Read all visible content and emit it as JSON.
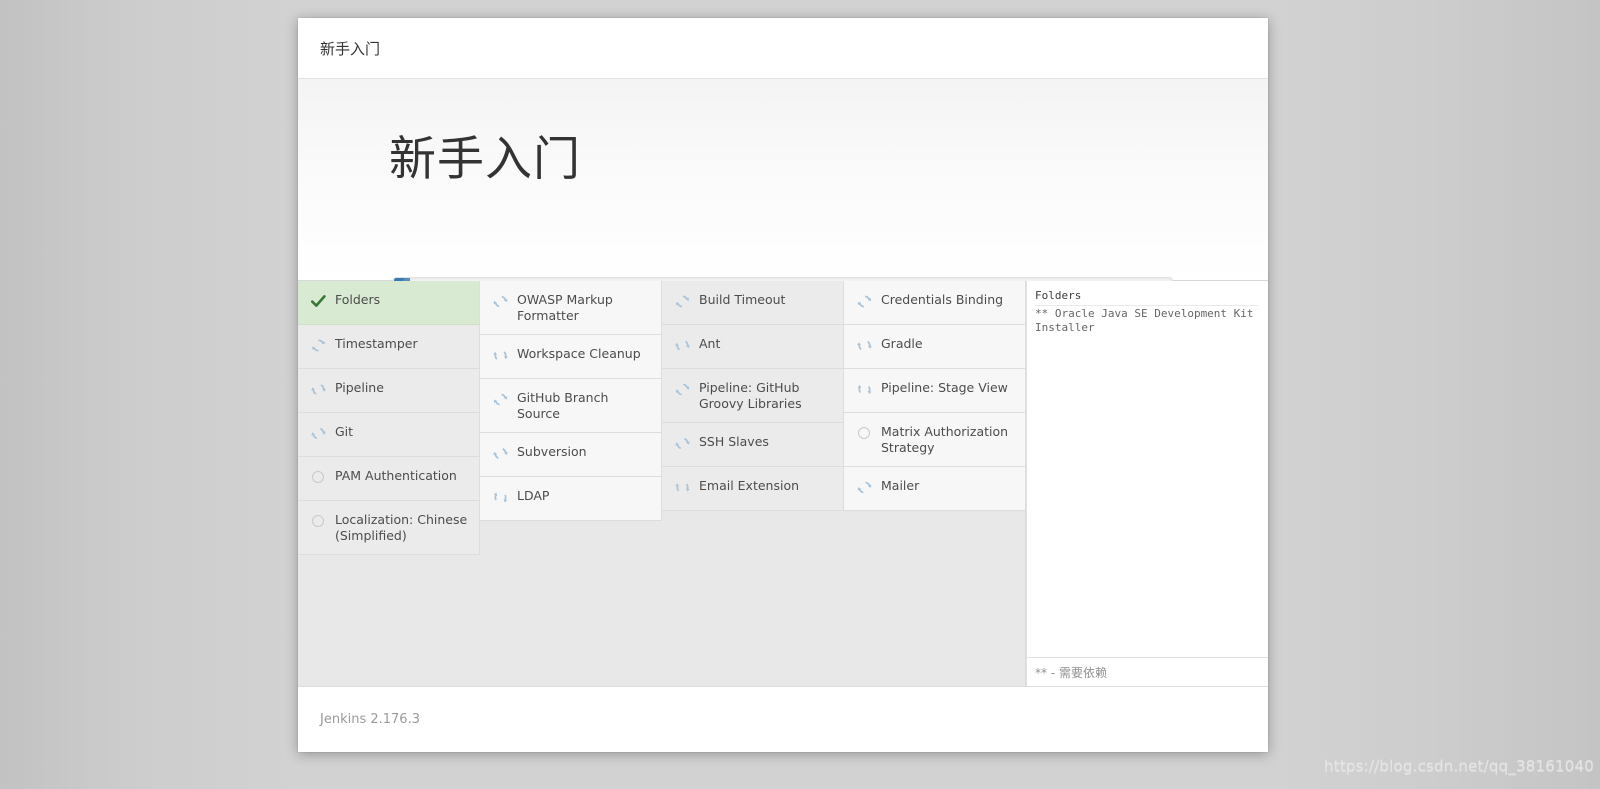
{
  "window": {
    "titlebar_text": "新手入门"
  },
  "hero": {
    "title": "新手入门",
    "progress_percent": 2,
    "progress_fill_color": "#3b7ab0",
    "progress_track_color": "#f3f3f3"
  },
  "status_colors": {
    "success_bg": "#d9ead3",
    "success_check": "#357935",
    "spinner": "#a9c3d8",
    "pending_ring": "#c9c9c9"
  },
  "plugin_grid": {
    "columns": [
      {
        "shade": "a",
        "cells": [
          {
            "label": "Folders",
            "status": "done"
          },
          {
            "label": "Timestamper",
            "status": "installing"
          },
          {
            "label": "Pipeline",
            "status": "installing"
          },
          {
            "label": "Git",
            "status": "installing"
          },
          {
            "label": "PAM Authentication",
            "status": "pending"
          },
          {
            "label": "Localization: Chinese (Simplified)",
            "status": "pending"
          }
        ]
      },
      {
        "shade": "b",
        "cells": [
          {
            "label": "OWASP Markup Formatter",
            "status": "installing"
          },
          {
            "label": "Workspace Cleanup",
            "status": "installing"
          },
          {
            "label": "GitHub Branch Source",
            "status": "installing"
          },
          {
            "label": "Subversion",
            "status": "installing"
          },
          {
            "label": "LDAP",
            "status": "installing"
          }
        ]
      },
      {
        "shade": "a",
        "cells": [
          {
            "label": "Build Timeout",
            "status": "installing"
          },
          {
            "label": "Ant",
            "status": "installing"
          },
          {
            "label": "Pipeline: GitHub Groovy Libraries",
            "status": "installing"
          },
          {
            "label": "SSH Slaves",
            "status": "installing"
          },
          {
            "label": "Email Extension",
            "status": "installing"
          }
        ]
      },
      {
        "shade": "b",
        "cells": [
          {
            "label": "Credentials Binding",
            "status": "installing"
          },
          {
            "label": "Gradle",
            "status": "installing"
          },
          {
            "label": "Pipeline: Stage View",
            "status": "installing"
          },
          {
            "label": "Matrix Authorization Strategy",
            "status": "pending"
          },
          {
            "label": "Mailer",
            "status": "installing"
          }
        ]
      }
    ]
  },
  "log_panel": {
    "lines": [
      {
        "text": "Folders",
        "emphasis": true
      },
      {
        "text": "** Oracle Java SE Development Kit Installer",
        "emphasis": false
      }
    ],
    "legend": "** - 需要依赖"
  },
  "footer": {
    "version": "Jenkins 2.176.3"
  },
  "watermark": {
    "text": "https://blog.csdn.net/qq_38161040"
  }
}
